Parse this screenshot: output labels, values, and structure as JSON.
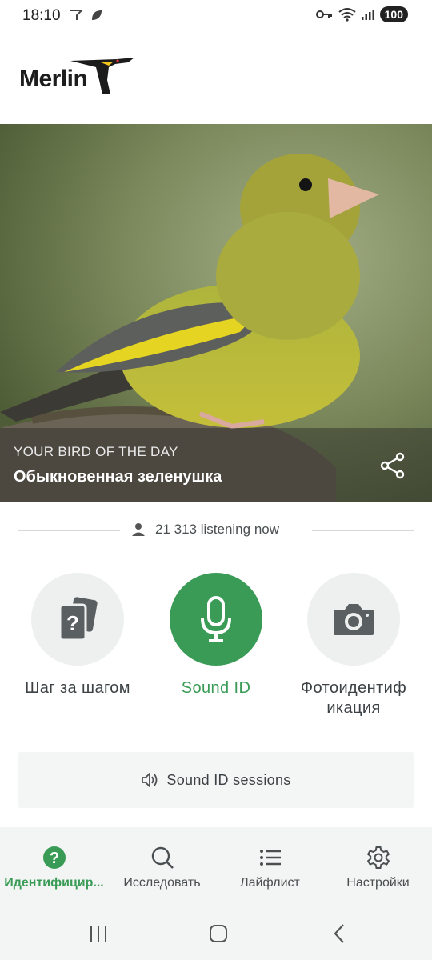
{
  "status_bar": {
    "time": "18:10",
    "battery": "100"
  },
  "header": {
    "logo_text": "Merlin"
  },
  "bird_of_day": {
    "kicker": "YOUR BIRD OF THE DAY",
    "name": "Обыкновенная зеленушка"
  },
  "listening": {
    "count_text": "21 313 listening now"
  },
  "actions": [
    {
      "label": "Шаг за шагом",
      "icon": "question-cards-icon"
    },
    {
      "label": "Sound ID",
      "icon": "microphone-icon"
    },
    {
      "label": "Фотоидентиф икация",
      "icon": "camera-icon"
    }
  ],
  "sessions": {
    "label": "Sound ID sessions",
    "icon": "speaker-icon"
  },
  "bottom_nav": [
    {
      "label": "Идентифицир...",
      "icon": "help-circle-icon",
      "active": true
    },
    {
      "label": "Исследовать",
      "icon": "search-icon",
      "active": false
    },
    {
      "label": "Лайфлист",
      "icon": "list-icon",
      "active": false
    },
    {
      "label": "Настройки",
      "icon": "gear-icon",
      "active": false
    }
  ],
  "colors": {
    "accent": "#3a9b57",
    "button_bg": "#edf0ee",
    "nav_bg": "#f2f5f3"
  }
}
